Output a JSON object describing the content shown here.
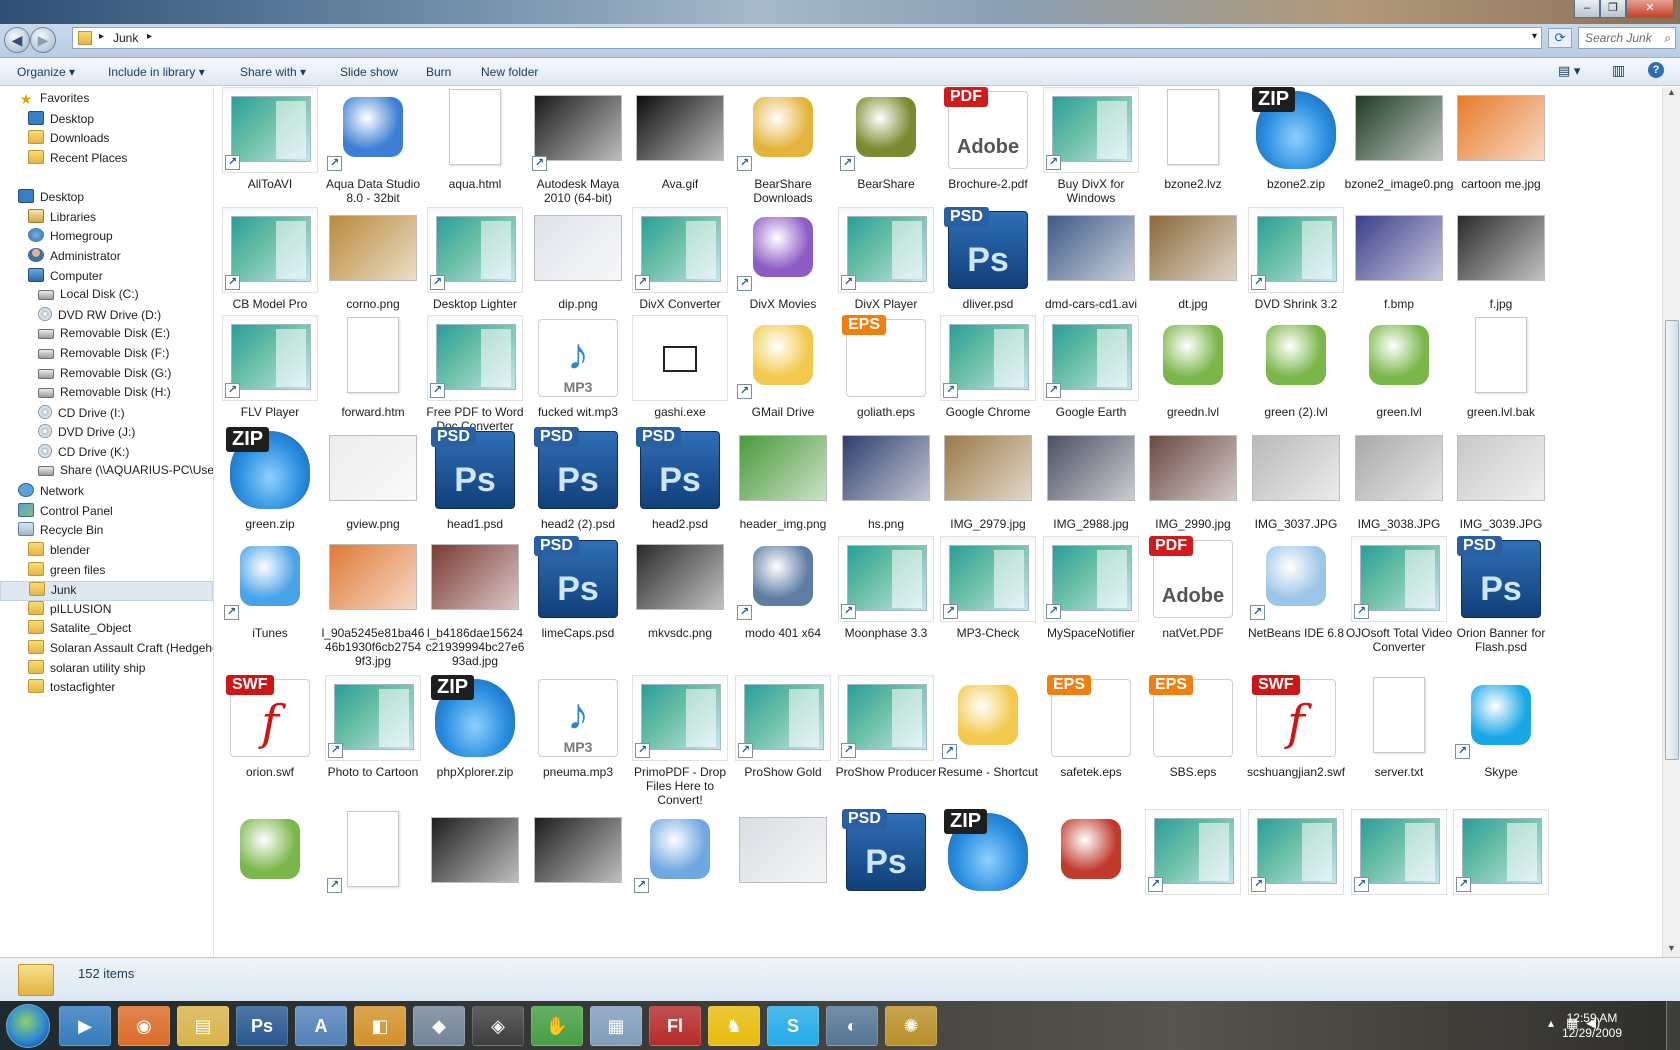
{
  "window": {
    "controls": [
      "–",
      "❐",
      "✕"
    ]
  },
  "address": {
    "path": [
      "Junk"
    ],
    "search_placeholder": "Search Junk"
  },
  "toolbar": {
    "organize": "Organize",
    "include": "Include in library",
    "share": "Share with",
    "slideshow": "Slide show",
    "burn": "Burn",
    "newfolder": "New folder"
  },
  "nav": [
    {
      "label": "Favorites",
      "icon": "star-icon"
    },
    {
      "label": "Desktop",
      "icon": "desktop-icon"
    },
    {
      "label": "Downloads",
      "icon": "downloads-icon"
    },
    {
      "label": "Recent Places",
      "icon": "recent-places-icon"
    },
    {
      "label": "Desktop",
      "icon": "desktop-icon"
    },
    {
      "label": "Libraries",
      "icon": "libraries-icon"
    },
    {
      "label": "Homegroup",
      "icon": "homegroup-icon"
    },
    {
      "label": "Administrator",
      "icon": "user-icon"
    },
    {
      "label": "Computer",
      "icon": "computer-icon"
    },
    {
      "label": "Local Disk (C:)",
      "icon": "drive-icon"
    },
    {
      "label": "DVD RW Drive (D:)",
      "icon": "disc-icon"
    },
    {
      "label": "Removable Disk (E:)",
      "icon": "drive-icon"
    },
    {
      "label": "Removable Disk (F:)",
      "icon": "drive-icon"
    },
    {
      "label": "Removable Disk (G:)",
      "icon": "drive-icon"
    },
    {
      "label": "Removable Disk (H:)",
      "icon": "drive-icon"
    },
    {
      "label": "CD Drive (I:)",
      "icon": "disc-icon"
    },
    {
      "label": "DVD Drive (J:)",
      "icon": "disc-icon"
    },
    {
      "label": "CD Drive (K:)",
      "icon": "disc-icon"
    },
    {
      "label": "Share (\\\\AQUARIUS-PC\\User",
      "icon": "network-drive-icon"
    },
    {
      "label": "Network",
      "icon": "network-icon"
    },
    {
      "label": "Control Panel",
      "icon": "control-panel-icon"
    },
    {
      "label": "Recycle Bin",
      "icon": "recycle-bin-icon"
    },
    {
      "label": "blender",
      "icon": "folder-icon"
    },
    {
      "label": "green files",
      "icon": "folder-icon"
    },
    {
      "label": "Junk",
      "icon": "folder-icon"
    },
    {
      "label": "pILLUSION",
      "icon": "folder-icon"
    },
    {
      "label": "Satalite_Object",
      "icon": "folder-icon"
    },
    {
      "label": "Solaran Assault Craft (Hedgeho",
      "icon": "folder-icon"
    },
    {
      "label": "solaran utility ship",
      "icon": "folder-icon"
    },
    {
      "label": "tostacfighter",
      "icon": "folder-icon"
    }
  ],
  "rows": [
    [
      {
        "name": "AllToAVI",
        "kind": "prog",
        "sc": true
      },
      {
        "name": "Aqua Data Studio 8.0 - 32bit",
        "kind": "icon",
        "sc": true,
        "color": "#3d7fd4"
      },
      {
        "name": "aqua.html",
        "kind": "blank"
      },
      {
        "name": "Autodesk Maya 2010 (64-bit)",
        "kind": "img",
        "color": "#1a1a1a",
        "sc": true
      },
      {
        "name": "Ava.gif",
        "kind": "img",
        "color": "#0e0e0e"
      },
      {
        "name": "BearShare Downloads",
        "kind": "icon",
        "color": "#e4b33c",
        "sc": true
      },
      {
        "name": "BearShare",
        "kind": "icon",
        "color": "#7b8a2e",
        "sc": true
      },
      {
        "name": "Brochure-2.pdf",
        "kind": "pdf",
        "badge": "PDF",
        "glyph": "Adobe"
      },
      {
        "name": "Buy DivX for Windows",
        "kind": "prog",
        "sc": true
      },
      {
        "name": "bzone2.lvz",
        "kind": "blank"
      },
      {
        "name": "bzone2.zip",
        "kind": "zip",
        "badge": "ZIP"
      },
      {
        "name": "bzone2_image0.png",
        "kind": "img",
        "color": "#1f3b22"
      },
      {
        "name": "cartoon me.jpg",
        "kind": "img",
        "color": "#e87a2c"
      }
    ],
    [
      {
        "name": "CB Model Pro",
        "kind": "prog",
        "sc": true
      },
      {
        "name": "corno.png",
        "kind": "img",
        "color": "#b98a3c"
      },
      {
        "name": "Desktop Lighter",
        "kind": "prog",
        "sc": true
      },
      {
        "name": "dip.png",
        "kind": "img",
        "color": "#dfe3ea"
      },
      {
        "name": "DivX Converter",
        "kind": "prog",
        "sc": true
      },
      {
        "name": "DivX Movies",
        "kind": "icon",
        "color": "#8e5cc6",
        "sc": true
      },
      {
        "name": "DivX Player",
        "kind": "prog",
        "sc": true
      },
      {
        "name": "dliver.psd",
        "kind": "psd",
        "badge": "PSD",
        "glyph": "Ps"
      },
      {
        "name": "dmd-cars-cd1.avi",
        "kind": "img",
        "color": "#3f5a86"
      },
      {
        "name": "dt.jpg",
        "kind": "img",
        "color": "#8a6a3a"
      },
      {
        "name": "DVD Shrink 3.2",
        "kind": "prog",
        "sc": true
      },
      {
        "name": "f.bmp",
        "kind": "img",
        "color": "#3b3f8a"
      },
      {
        "name": "f.jpg",
        "kind": "img",
        "color": "#2a2a2a"
      }
    ],
    [
      {
        "name": "FLV Player",
        "kind": "prog",
        "sc": true
      },
      {
        "name": "forward.htm",
        "kind": "blank"
      },
      {
        "name": "Free PDF to Word Doc Converter",
        "kind": "prog",
        "sc": true
      },
      {
        "name": "fucked wit.mp3",
        "kind": "mp3",
        "glyph": "♪",
        "badge": "MP3"
      },
      {
        "name": "gashi.exe",
        "kind": "exe"
      },
      {
        "name": "GMail Drive",
        "kind": "icon",
        "color": "#f2c94c",
        "sc": true
      },
      {
        "name": "goliath.eps",
        "kind": "eps",
        "badge": "EPS"
      },
      {
        "name": "Google Chrome",
        "kind": "prog",
        "sc": true
      },
      {
        "name": "Google Earth",
        "kind": "prog",
        "sc": true
      },
      {
        "name": "greedn.lvl",
        "kind": "icon",
        "color": "#7ab648"
      },
      {
        "name": "green (2).lvl",
        "kind": "icon",
        "color": "#7ab648"
      },
      {
        "name": "green.lvl",
        "kind": "icon",
        "color": "#7ab648"
      },
      {
        "name": "green.lvl.bak",
        "kind": "blank"
      }
    ],
    [
      {
        "name": "green.zip",
        "kind": "zip",
        "badge": "ZIP"
      },
      {
        "name": "gview.png",
        "kind": "img",
        "color": "#ececec"
      },
      {
        "name": "head1.psd",
        "kind": "psd",
        "badge": "PSD",
        "glyph": "Ps"
      },
      {
        "name": "head2 (2).psd",
        "kind": "psd",
        "badge": "PSD",
        "glyph": "Ps"
      },
      {
        "name": "head2.psd",
        "kind": "psd",
        "badge": "PSD",
        "glyph": "Ps"
      },
      {
        "name": "header_img.png",
        "kind": "img",
        "color": "#4a9a3a"
      },
      {
        "name": "hs.png",
        "kind": "img",
        "color": "#2c3e6b"
      },
      {
        "name": "IMG_2979.jpg",
        "kind": "img",
        "color": "#9a7a48"
      },
      {
        "name": "IMG_2988.jpg",
        "kind": "img",
        "color": "#4b5062"
      },
      {
        "name": "IMG_2990.jpg",
        "kind": "img",
        "color": "#6a4a42"
      },
      {
        "name": "IMG_3037.JPG",
        "kind": "img",
        "color": "#b9b9b9"
      },
      {
        "name": "IMG_3038.JPG",
        "kind": "img",
        "color": "#a9a9a9"
      },
      {
        "name": "IMG_3039.JPG",
        "kind": "img",
        "color": "#c8c8c8"
      }
    ],
    [
      {
        "name": "iTunes",
        "kind": "icon",
        "color": "#4aa3e8",
        "sc": true
      },
      {
        "name": "l_90a5245e81ba46 46b1930f6cb2754 9f3.jpg",
        "kind": "img",
        "color": "#e07a36"
      },
      {
        "name": "l_b4186dae15624 c21939994bc27e6 93ad.jpg",
        "kind": "img",
        "color": "#7a3a34"
      },
      {
        "name": "limeCaps.psd",
        "kind": "psd",
        "badge": "PSD",
        "glyph": "Ps"
      },
      {
        "name": "mkvsdc.png",
        "kind": "img",
        "color": "#2a2a2a"
      },
      {
        "name": "modo 401 x64",
        "kind": "icon",
        "color": "#5e7da3",
        "sc": true
      },
      {
        "name": "Moonphase 3.3",
        "kind": "prog",
        "sc": true
      },
      {
        "name": "MP3-Check",
        "kind": "prog",
        "sc": true
      },
      {
        "name": "MySpaceNotifier",
        "kind": "prog",
        "sc": true
      },
      {
        "name": "natVet.PDF",
        "kind": "pdf",
        "badge": "PDF",
        "glyph": "Adobe"
      },
      {
        "name": "NetBeans IDE 6.8",
        "kind": "icon",
        "color": "#9cc6e8",
        "sc": true
      },
      {
        "name": "OJOsoft Total Video Converter",
        "kind": "prog",
        "sc": true
      },
      {
        "name": "Orion Banner for Flash.psd",
        "kind": "psd",
        "badge": "PSD",
        "glyph": "Ps"
      }
    ],
    [
      {
        "name": "orion.swf",
        "kind": "swf",
        "badge": "SWF",
        "glyph": "f"
      },
      {
        "name": "Photo to Cartoon",
        "kind": "prog",
        "sc": true
      },
      {
        "name": "phpXplorer.zip",
        "kind": "zip",
        "badge": "ZIP"
      },
      {
        "name": "pneuma.mp3",
        "kind": "mp3",
        "glyph": "♪",
        "badge": "MP3"
      },
      {
        "name": "PrimoPDF - Drop Files Here to Convert!",
        "kind": "prog",
        "sc": true
      },
      {
        "name": "ProShow Gold",
        "kind": "prog",
        "sc": true
      },
      {
        "name": "ProShow Producer",
        "kind": "prog",
        "sc": true
      },
      {
        "name": "Resume - Shortcut",
        "kind": "icon",
        "color": "#f2c94c",
        "sc": true
      },
      {
        "name": "safetek.eps",
        "kind": "eps",
        "badge": "EPS"
      },
      {
        "name": "SBS.eps",
        "kind": "eps",
        "badge": "EPS"
      },
      {
        "name": "scshuangjian2.swf",
        "kind": "swf",
        "badge": "SWF",
        "glyph": "f"
      },
      {
        "name": "server.txt",
        "kind": "blank"
      },
      {
        "name": "Skype",
        "kind": "icon",
        "color": "#19a7e6",
        "sc": true
      }
    ],
    [
      {
        "name": "",
        "kind": "icon",
        "color": "#7ab648"
      },
      {
        "name": "",
        "kind": "blank",
        "sc": true
      },
      {
        "name": "",
        "kind": "img",
        "color": "#1e1e1e"
      },
      {
        "name": "",
        "kind": "img",
        "color": "#1e1e1e"
      },
      {
        "name": "",
        "kind": "icon",
        "color": "#6fa8e0",
        "sc": true
      },
      {
        "name": "",
        "kind": "img",
        "color": "#d9dde3"
      },
      {
        "name": "",
        "kind": "psd",
        "badge": "PSD",
        "glyph": "Ps"
      },
      {
        "name": "",
        "kind": "zip",
        "badge": "ZIP"
      },
      {
        "name": "",
        "kind": "icon",
        "color": "#c0392b"
      },
      {
        "name": "",
        "kind": "prog",
        "sc": true
      },
      {
        "name": "",
        "kind": "prog",
        "sc": true
      },
      {
        "name": "",
        "kind": "prog",
        "sc": true
      },
      {
        "name": "",
        "kind": "prog",
        "sc": true
      }
    ]
  ],
  "status": {
    "count": "152 items"
  },
  "taskbar": {
    "apps": [
      {
        "name": "media-player-icon",
        "glyph": "▶",
        "color": "#2a74b8"
      },
      {
        "name": "firefox-icon",
        "glyph": "◉",
        "color": "#d8641e"
      },
      {
        "name": "explorer-icon",
        "glyph": "▤",
        "color": "#d6b040"
      },
      {
        "name": "photoshop-icon",
        "glyph": "Ps",
        "color": "#1d4f8a"
      },
      {
        "name": "wordpad-icon",
        "glyph": "A",
        "color": "#4a7ab5"
      },
      {
        "name": "app-icon",
        "glyph": "◧",
        "color": "#d08b1e"
      },
      {
        "name": "modo-icon",
        "glyph": "◆",
        "color": "#6c7d92"
      },
      {
        "name": "maya-icon",
        "glyph": "◈",
        "color": "#333"
      },
      {
        "name": "hand-icon",
        "glyph": "✋",
        "color": "#3a9a3a"
      },
      {
        "name": "calculator-icon",
        "glyph": "▦",
        "color": "#7a98b8"
      },
      {
        "name": "flash-icon",
        "glyph": "Fl",
        "color": "#b0201e"
      },
      {
        "name": "aim-icon",
        "glyph": "♞",
        "color": "#e6b800"
      },
      {
        "name": "skype-icon",
        "glyph": "S",
        "color": "#19a7e6"
      },
      {
        "name": "browser-icon",
        "glyph": "◐",
        "color": "#4b6e8e"
      },
      {
        "name": "app2-icon",
        "glyph": "✺",
        "color": "#b58a1e"
      }
    ],
    "time": "12:59 AM",
    "date": "12/29/2009"
  }
}
